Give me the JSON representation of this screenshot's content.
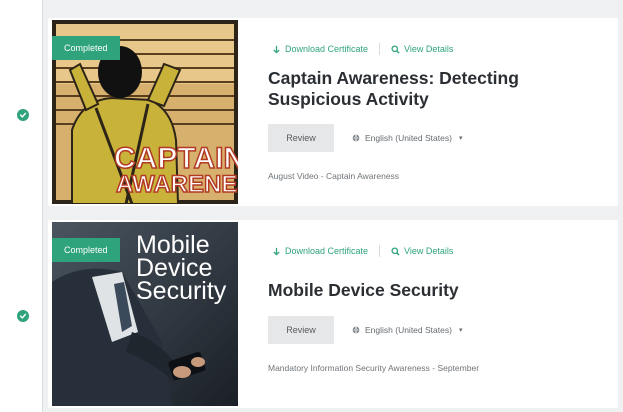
{
  "colors": {
    "accent": "#2fa37c",
    "title": "#2b2f33",
    "muted": "#6f757a",
    "button_bg": "#e6e7e8",
    "page_bg": "#eef0f1"
  },
  "courses": [
    {
      "status_badge": "Completed",
      "status_icon": "check-circle-icon",
      "thumbnail": {
        "description_icon": "captain-awareness-comic-art",
        "wordmark_top": "CAPTAIN",
        "wordmark_bottom": "AWARENESS"
      },
      "download_label": "Download Certificate",
      "view_label": "View Details",
      "title": "Captain Awareness: Detecting Suspicious Activity",
      "review_label": "Review",
      "language": "English (United States)",
      "subtitle": "August Video - Captain Awareness"
    },
    {
      "status_badge": "Completed",
      "status_icon": "check-circle-icon",
      "thumbnail": {
        "description_icon": "businessman-with-phone-photo",
        "overlay_text": "Mobile\nDevice\nSecurity"
      },
      "download_label": "Download Certificate",
      "view_label": "View Details",
      "title": "Mobile Device Security",
      "review_label": "Review",
      "language": "English (United States)",
      "subtitle": "Mandatory Information Security Awareness - September"
    }
  ]
}
